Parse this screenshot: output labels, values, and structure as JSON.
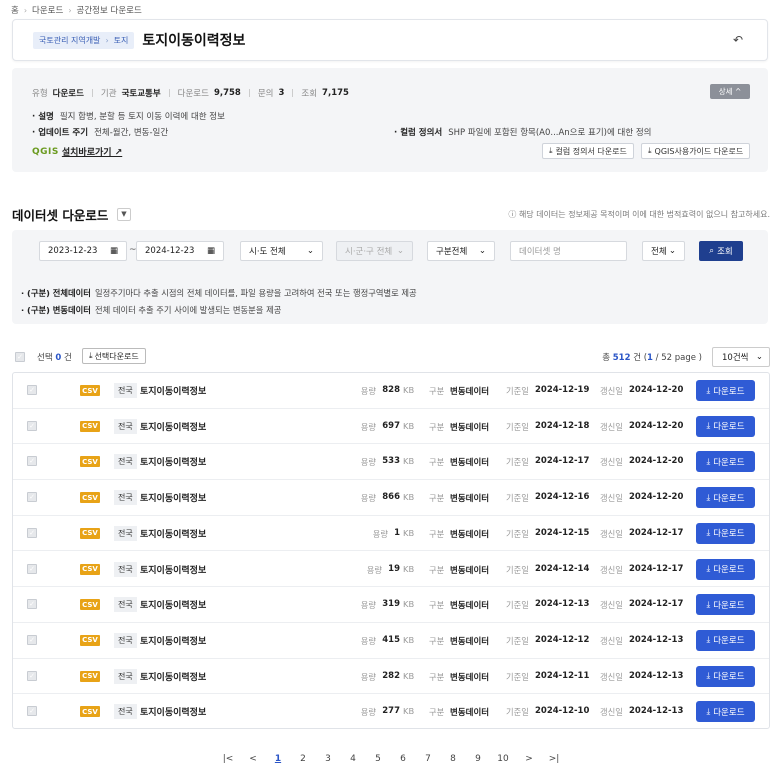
{
  "breadcrumb": [
    "홈",
    "다운로드",
    "공간정보 다운로드"
  ],
  "header": {
    "category_path": [
      "국토관리 지역개발",
      "토지"
    ],
    "title": "토지이동이력정보"
  },
  "meta": {
    "type_label": "유형",
    "type_value": "다운로드",
    "agency_label": "기관",
    "agency_value": "국토교통부",
    "downloads_label": "다운로드",
    "downloads_value": "9,758",
    "inquiries_label": "문의",
    "inquiries_value": "3",
    "views_label": "조회",
    "views_value": "7,175",
    "detail_button": "상세 ^"
  },
  "info": {
    "desc_label": "· 설명",
    "desc_value": "필지 합병, 분할 등 토지 이동 이력에 대한 정보",
    "cycle_label": "· 업데이트 주기",
    "cycle_value": "전체-월간, 변동-일간",
    "column_label": "· 컬럼 정의서",
    "column_value": "SHP 파일에 포함된 항목(A0...An으로 표기)에 대한 정의",
    "qgis_logo": "QGIS",
    "qgis_link": "설치바로가기 ↗",
    "column_dl_button": "컬럼 정의서 다운로드",
    "qgis_guide_button": "QGIS사용가이드 다운로드"
  },
  "dataset": {
    "title": "데이터셋 다운로드",
    "notice": "ⓘ 해당 데이터는 정보제공 목적이며 이에 대한 법적효력이 없으니 참고하세요."
  },
  "filters": {
    "date_from": "2023-12-23",
    "date_to": "2024-12-23",
    "tilde": "~",
    "sido": "시·도 전체",
    "sigungu": "시·군·구 전체",
    "gubun": "구분전체",
    "name_placeholder": "데이터셋 명",
    "scope": "전체",
    "search_button": "조회",
    "note1_label": "· (구분) 전체데이터",
    "note1_value": "일정주기마다 추출 시점의 전체 데이터를, 파일 용량을 고려하여 전국 또는 행정구역별로 제공",
    "note2_label": "· (구분) 변동데이터",
    "note2_value": "전체 데이터 추출 주기 사이에 발생되는 변동분을 제공"
  },
  "list": {
    "select_prefix": "선택",
    "selected_count": "0",
    "select_suffix": "건",
    "select_download_button": "선택다운로드",
    "total_prefix": "총",
    "total_count": "512",
    "total_suffix": "건 (",
    "current_page": "1",
    "total_pages": "/ 52 page )",
    "per_page": "10건씩",
    "labels": {
      "size": "용량",
      "unit": "KB",
      "gubun": "구분",
      "base_date": "기준일",
      "update_date": "갱신일",
      "download": "다운로드",
      "format": "CSV"
    },
    "rows": [
      {
        "region": "전국",
        "name": "토지이동이력정보",
        "size": "828",
        "gubun": "변동데이터",
        "base": "2024-12-19",
        "updated": "2024-12-20"
      },
      {
        "region": "전국",
        "name": "토지이동이력정보",
        "size": "697",
        "gubun": "변동데이터",
        "base": "2024-12-18",
        "updated": "2024-12-20"
      },
      {
        "region": "전국",
        "name": "토지이동이력정보",
        "size": "533",
        "gubun": "변동데이터",
        "base": "2024-12-17",
        "updated": "2024-12-20"
      },
      {
        "region": "전국",
        "name": "토지이동이력정보",
        "size": "866",
        "gubun": "변동데이터",
        "base": "2024-12-16",
        "updated": "2024-12-20"
      },
      {
        "region": "전국",
        "name": "토지이동이력정보",
        "size": "1",
        "gubun": "변동데이터",
        "base": "2024-12-15",
        "updated": "2024-12-17"
      },
      {
        "region": "전국",
        "name": "토지이동이력정보",
        "size": "19",
        "gubun": "변동데이터",
        "base": "2024-12-14",
        "updated": "2024-12-17"
      },
      {
        "region": "전국",
        "name": "토지이동이력정보",
        "size": "319",
        "gubun": "변동데이터",
        "base": "2024-12-13",
        "updated": "2024-12-17"
      },
      {
        "region": "전국",
        "name": "토지이동이력정보",
        "size": "415",
        "gubun": "변동데이터",
        "base": "2024-12-12",
        "updated": "2024-12-13"
      },
      {
        "region": "전국",
        "name": "토지이동이력정보",
        "size": "282",
        "gubun": "변동데이터",
        "base": "2024-12-11",
        "updated": "2024-12-13"
      },
      {
        "region": "전국",
        "name": "토지이동이력정보",
        "size": "277",
        "gubun": "변동데이터",
        "base": "2024-12-10",
        "updated": "2024-12-13"
      }
    ]
  },
  "pagination": {
    "first": "|<",
    "prev": "<",
    "next": ">",
    "last": ">|",
    "pages": [
      "1",
      "2",
      "3",
      "4",
      "5",
      "6",
      "7",
      "8",
      "9",
      "10"
    ],
    "active": "1"
  },
  "colors": {
    "primary": "#2f5bd5",
    "navy": "#1f3f8f",
    "csv": "#e8a317"
  }
}
